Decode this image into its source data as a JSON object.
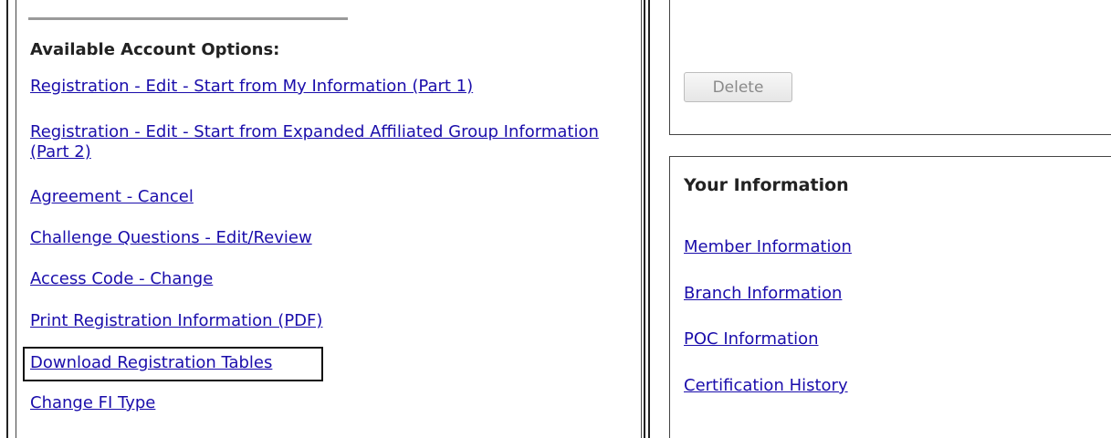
{
  "account_options": {
    "heading": "Available Account Options:",
    "links": [
      "Registration - Edit - Start from My Information (Part 1)",
      "Registration - Edit - Start from Expanded Affiliated Group Information (Part 2)",
      "Agreement - Cancel",
      "Challenge Questions - Edit/Review",
      "Access Code - Change",
      "Print Registration Information (PDF)",
      "Download Registration Tables",
      "Change FI Type"
    ]
  },
  "actions": {
    "delete_label": "Delete"
  },
  "your_information": {
    "heading": "Your Information",
    "links": [
      "Member Information",
      "Branch Information",
      "POC Information",
      "Certification History"
    ]
  },
  "colors": {
    "link": "#1a0dab",
    "text": "#222222",
    "button_text": "#8a8a8a"
  }
}
